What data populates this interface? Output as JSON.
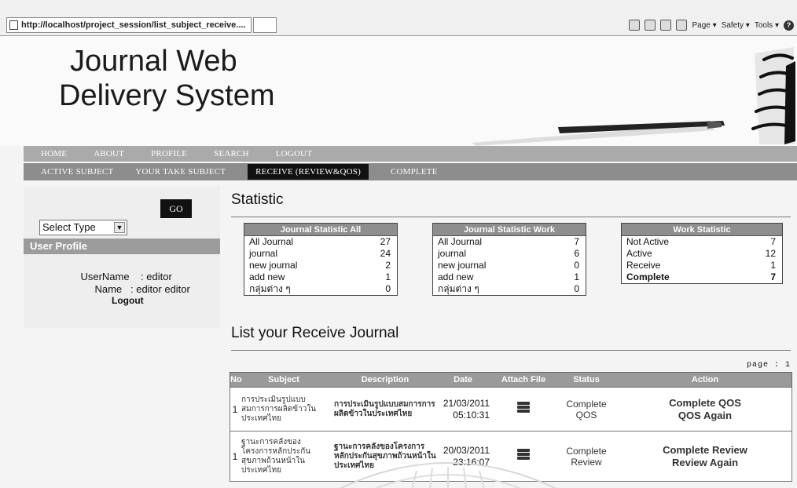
{
  "browser": {
    "url": "http://localhost/project_session/list_subject_receive....",
    "cmd_items": [
      "Page",
      "Safety",
      "Tools"
    ]
  },
  "site": {
    "title_line1": "Journal Web",
    "title_line2": "Delivery System"
  },
  "nav_main": [
    "HOME",
    "ABOUT",
    "PROFILE",
    "SEARCH",
    "LOGOUT"
  ],
  "nav_sub": [
    "ACTIVE SUBJECT",
    "YOUR TAKE SUBJECT",
    "RECEIVE (REVIEW&QOS)",
    "COMPLETE"
  ],
  "nav_sub_active": "RECEIVE (REVIEW&QOS)",
  "sidebar": {
    "go_label": "GO",
    "select_value": "Select Type",
    "profile_title": "User Profile",
    "username_label": "UserName",
    "username_value": ": editor",
    "name_label": "Name",
    "name_value": ": editor editor",
    "logout_label": "Logout"
  },
  "main": {
    "statistic_title": "Statistic",
    "list_title": "List your Receive Journal",
    "page_label": "page : 1"
  },
  "stats_all": {
    "title": "Journal Statistic All",
    "rows": [
      {
        "label": "All Journal",
        "value": "27"
      },
      {
        "label": "journal",
        "value": "24"
      },
      {
        "label": "new journal",
        "value": "2"
      },
      {
        "label": "add new",
        "value": "1"
      },
      {
        "label": "กลุ่มต่าง ๆ",
        "value": "0"
      }
    ]
  },
  "stats_work": {
    "title": "Journal Statistic Work",
    "rows": [
      {
        "label": "All Journal",
        "value": "7"
      },
      {
        "label": "journal",
        "value": "6"
      },
      {
        "label": "new journal",
        "value": "0"
      },
      {
        "label": "add new",
        "value": "1"
      },
      {
        "label": "กลุ่มต่าง ๆ",
        "value": "0"
      }
    ]
  },
  "stats_status": {
    "title": "Work Statistic",
    "rows": [
      {
        "label": "Not Active",
        "value": "7"
      },
      {
        "label": "Active",
        "value": "12"
      },
      {
        "label": "Receive",
        "value": "1"
      },
      {
        "label": "Complete",
        "value": "7"
      }
    ]
  },
  "table": {
    "headers": [
      "No",
      "Subject",
      "Description",
      "Date",
      "Attach File",
      "Status",
      "Action"
    ],
    "rows": [
      {
        "no": "1",
        "subject": "การประเมินรูปแบบสมการการผลิตข้าวในประเทศไทย",
        "description": "การประเมินรูปแบบสมการการผลิตข้าวในประเทศไทย",
        "date": "21/03/2011",
        "time": "05:10:31",
        "status_line1": "Complete",
        "status_line2": "QOS",
        "action_line1": "Complete QOS",
        "action_line2": "QOS Again"
      },
      {
        "no": "1",
        "subject": "ฐานะการคลังของโครงการหลักประกันสุขภาพถ้วนหน้าในประเทศไทย",
        "description": "ฐานะการคลังของโครงการหลักประกันสุขภาพถ้วนหน้าในประเทศไทย",
        "date": "20/03/2011",
        "time": "23:16:07",
        "status_line1": "Complete",
        "status_line2": "Review",
        "action_line1": "Complete Review",
        "action_line2": "Review Again"
      }
    ]
  }
}
